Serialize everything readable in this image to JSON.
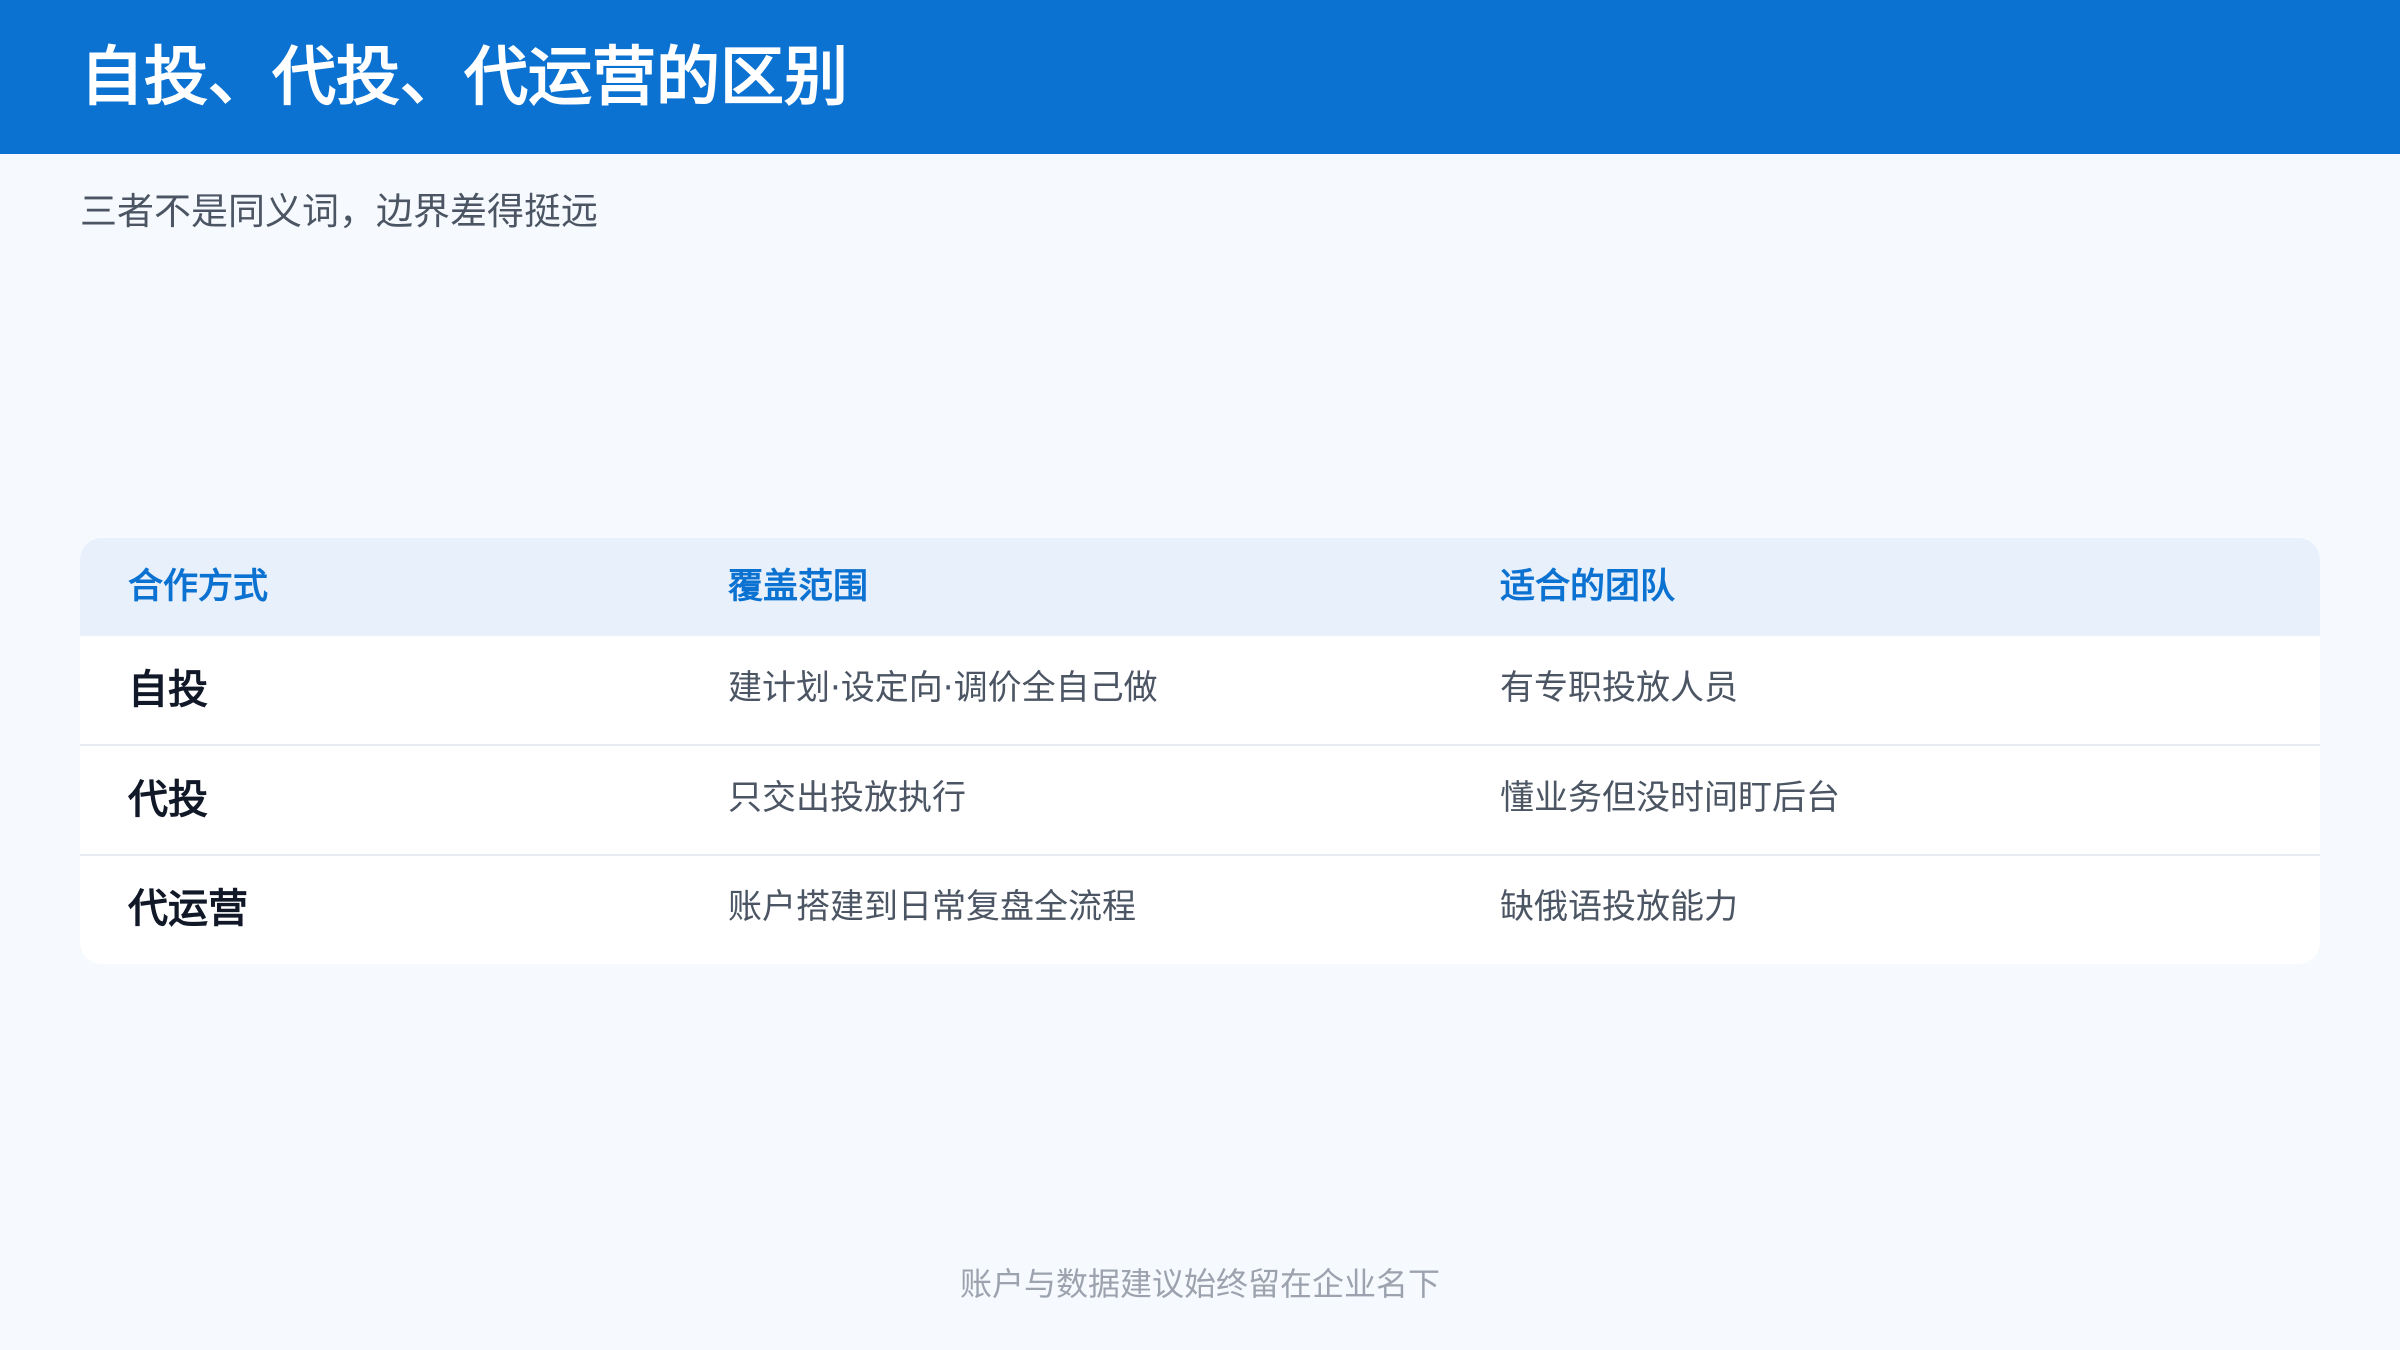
{
  "header": {
    "title": "自投、代投、代运营的区别",
    "background_color": "#0b72d2"
  },
  "subtitle": "三者不是同义词，边界差得挺远",
  "table": {
    "columns": [
      "合作方式",
      "覆盖范围",
      "适合的团队"
    ],
    "rows": [
      {
        "mode": "自投",
        "scope": "建计划·设定向·调价全自己做",
        "team": "有专职投放人员"
      },
      {
        "mode": "代投",
        "scope": "只交出投放执行",
        "team": "懂业务但没时间盯后台"
      },
      {
        "mode": "代运营",
        "scope": "账户搭建到日常复盘全流程",
        "team": "缺俄语投放能力"
      }
    ],
    "header_color": "#0b72d2",
    "header_background": "#e7f0fb"
  },
  "footer": "账户与数据建议始终留在企业名下"
}
